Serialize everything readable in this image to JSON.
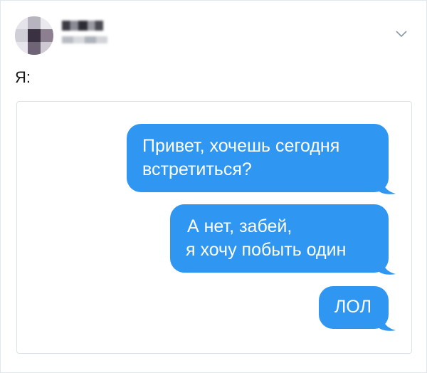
{
  "tweet": {
    "display_name": "▆▆▆▆",
    "handle": "▆▆▆▆▆",
    "text": "Я:",
    "menu_icon": "chevron-down-icon"
  },
  "conversation": {
    "bubble_color": "#2f97f2",
    "messages": [
      {
        "lines": [
          "Привет, хочешь сегодня",
          "встретиться?"
        ]
      },
      {
        "lines": [
          "А нет, забей,",
          "я хочу побыть один"
        ]
      },
      {
        "lines": [
          "ЛОЛ"
        ]
      }
    ]
  }
}
